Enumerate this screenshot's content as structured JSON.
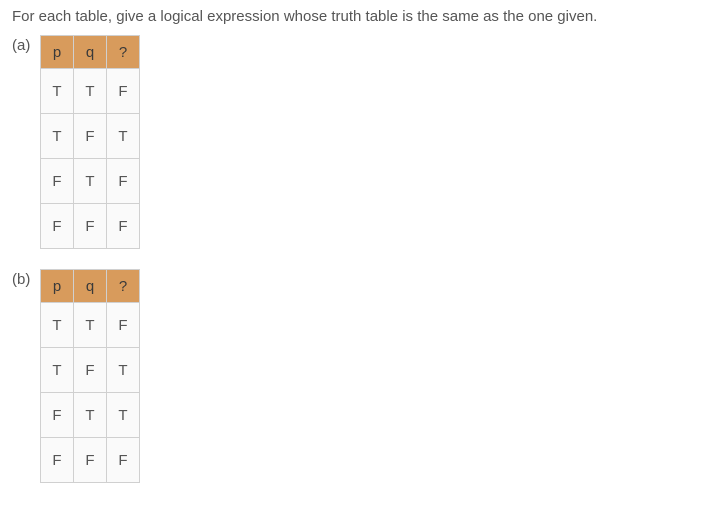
{
  "prompt": "For each table, give a logical expression whose truth table is the same as the one given.",
  "tables": {
    "a": {
      "label": "(a)",
      "headers": [
        "p",
        "q",
        "?"
      ],
      "rows": [
        [
          "T",
          "T",
          "F"
        ],
        [
          "T",
          "F",
          "T"
        ],
        [
          "F",
          "T",
          "F"
        ],
        [
          "F",
          "F",
          "F"
        ]
      ]
    },
    "b": {
      "label": "(b)",
      "headers": [
        "p",
        "q",
        "?"
      ],
      "rows": [
        [
          "T",
          "T",
          "F"
        ],
        [
          "T",
          "F",
          "T"
        ],
        [
          "F",
          "T",
          "T"
        ],
        [
          "F",
          "F",
          "F"
        ]
      ]
    }
  }
}
